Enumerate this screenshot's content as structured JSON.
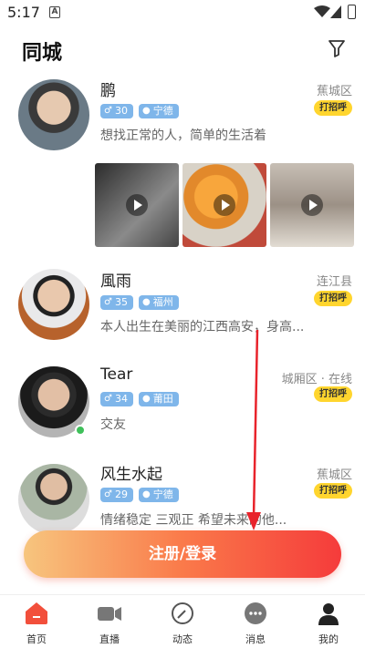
{
  "status_bar": {
    "time": "5:17",
    "notif_glyph": "A"
  },
  "header": {
    "title": "同城"
  },
  "users": [
    {
      "name": "鹏",
      "age": "30",
      "city": "宁德",
      "bio": "想找正常的人，简单的生活着",
      "location": "蕉城区",
      "hi": "打招呼",
      "gender_icon": "male-icon"
    },
    {
      "name": "風雨",
      "age": "35",
      "city": "福州",
      "bio": "本人出生在美丽的江西高安，身高...",
      "location": "连江县",
      "hi": "打招呼",
      "gender_icon": "male-icon"
    },
    {
      "name": "Tear",
      "age": "34",
      "city": "莆田",
      "bio": "交友",
      "location": "城厢区 · 在线",
      "hi": "打招呼",
      "gender_icon": "male-icon"
    },
    {
      "name": "风生水起",
      "age": "29",
      "city": "宁德",
      "bio": "情绪稳定 三观正 希望未来的他...",
      "location": "蕉城区",
      "hi": "打招呼",
      "gender_icon": "male-icon"
    }
  ],
  "register_button": {
    "label": "注册/登录"
  },
  "nav": [
    {
      "label": "首页",
      "icon": "home-icon"
    },
    {
      "label": "直播",
      "icon": "camera-icon"
    },
    {
      "label": "动态",
      "icon": "compass-icon"
    },
    {
      "label": "消息",
      "icon": "chat-icon"
    },
    {
      "label": "我的",
      "icon": "person-icon"
    }
  ],
  "colors": {
    "accent": "#f53b3b",
    "tag": "#7fb6ea",
    "hi": "#ffd52e",
    "online": "#3fc05a"
  }
}
